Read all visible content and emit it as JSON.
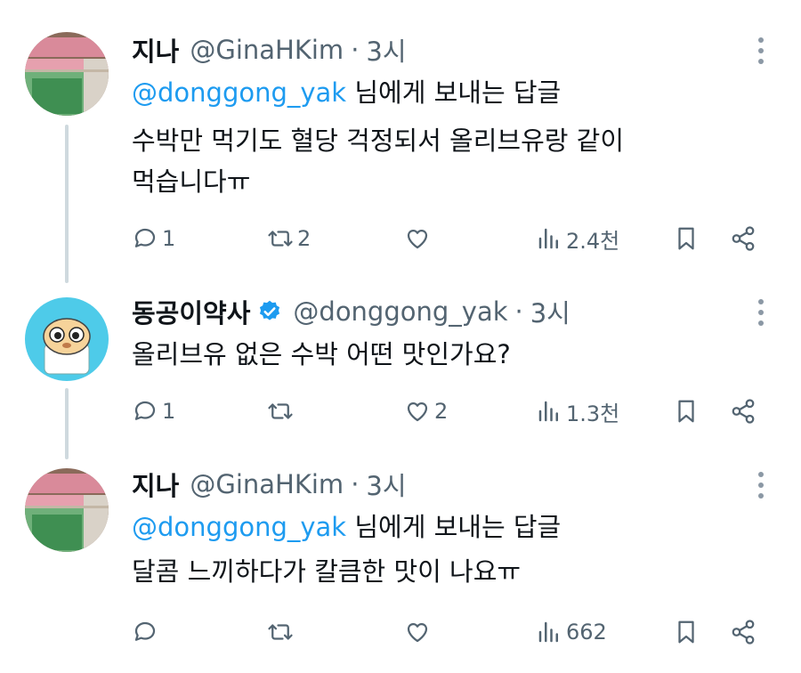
{
  "tweets": [
    {
      "name": "지나",
      "handle": "@GinaHKim",
      "dot": "·",
      "time": "3시",
      "reply_mention": "@donggong_yak",
      "reply_suffix": " 님에게 보내는 답글",
      "lines": [
        "수박만 먹기도 혈당 걱정되서 올리브유랑 같이",
        "먹습니다ㅠ"
      ],
      "stats": {
        "replies": "1",
        "retweets": "2",
        "likes": "",
        "views": "2.4천"
      }
    },
    {
      "name": "동공이약사",
      "handle": "@donggong_yak",
      "dot": "·",
      "time": "3시",
      "verified": true,
      "lines": [
        "올리브유 없은 수박 어떤 맛인가요?"
      ],
      "stats": {
        "replies": "1",
        "retweets": "",
        "likes": "2",
        "views": "1.3천"
      }
    },
    {
      "name": "지나",
      "handle": "@GinaHKim",
      "dot": "·",
      "time": "3시",
      "reply_mention": "@donggong_yak",
      "reply_suffix": " 님에게 보내는 답글",
      "lines": [
        "달콤 느끼하다가 칼큼한 맛이 나요ㅠ"
      ],
      "stats": {
        "replies": "",
        "retweets": "",
        "likes": "",
        "views": "662"
      }
    }
  ],
  "colors": {
    "accent": "#1d9bf0",
    "muted": "#536471",
    "thread": "#cfd9de"
  },
  "icons": [
    "reply-icon",
    "retweet-icon",
    "like-icon",
    "views-icon",
    "bookmark-icon",
    "share-icon",
    "more-icon",
    "verified-badge-icon"
  ]
}
